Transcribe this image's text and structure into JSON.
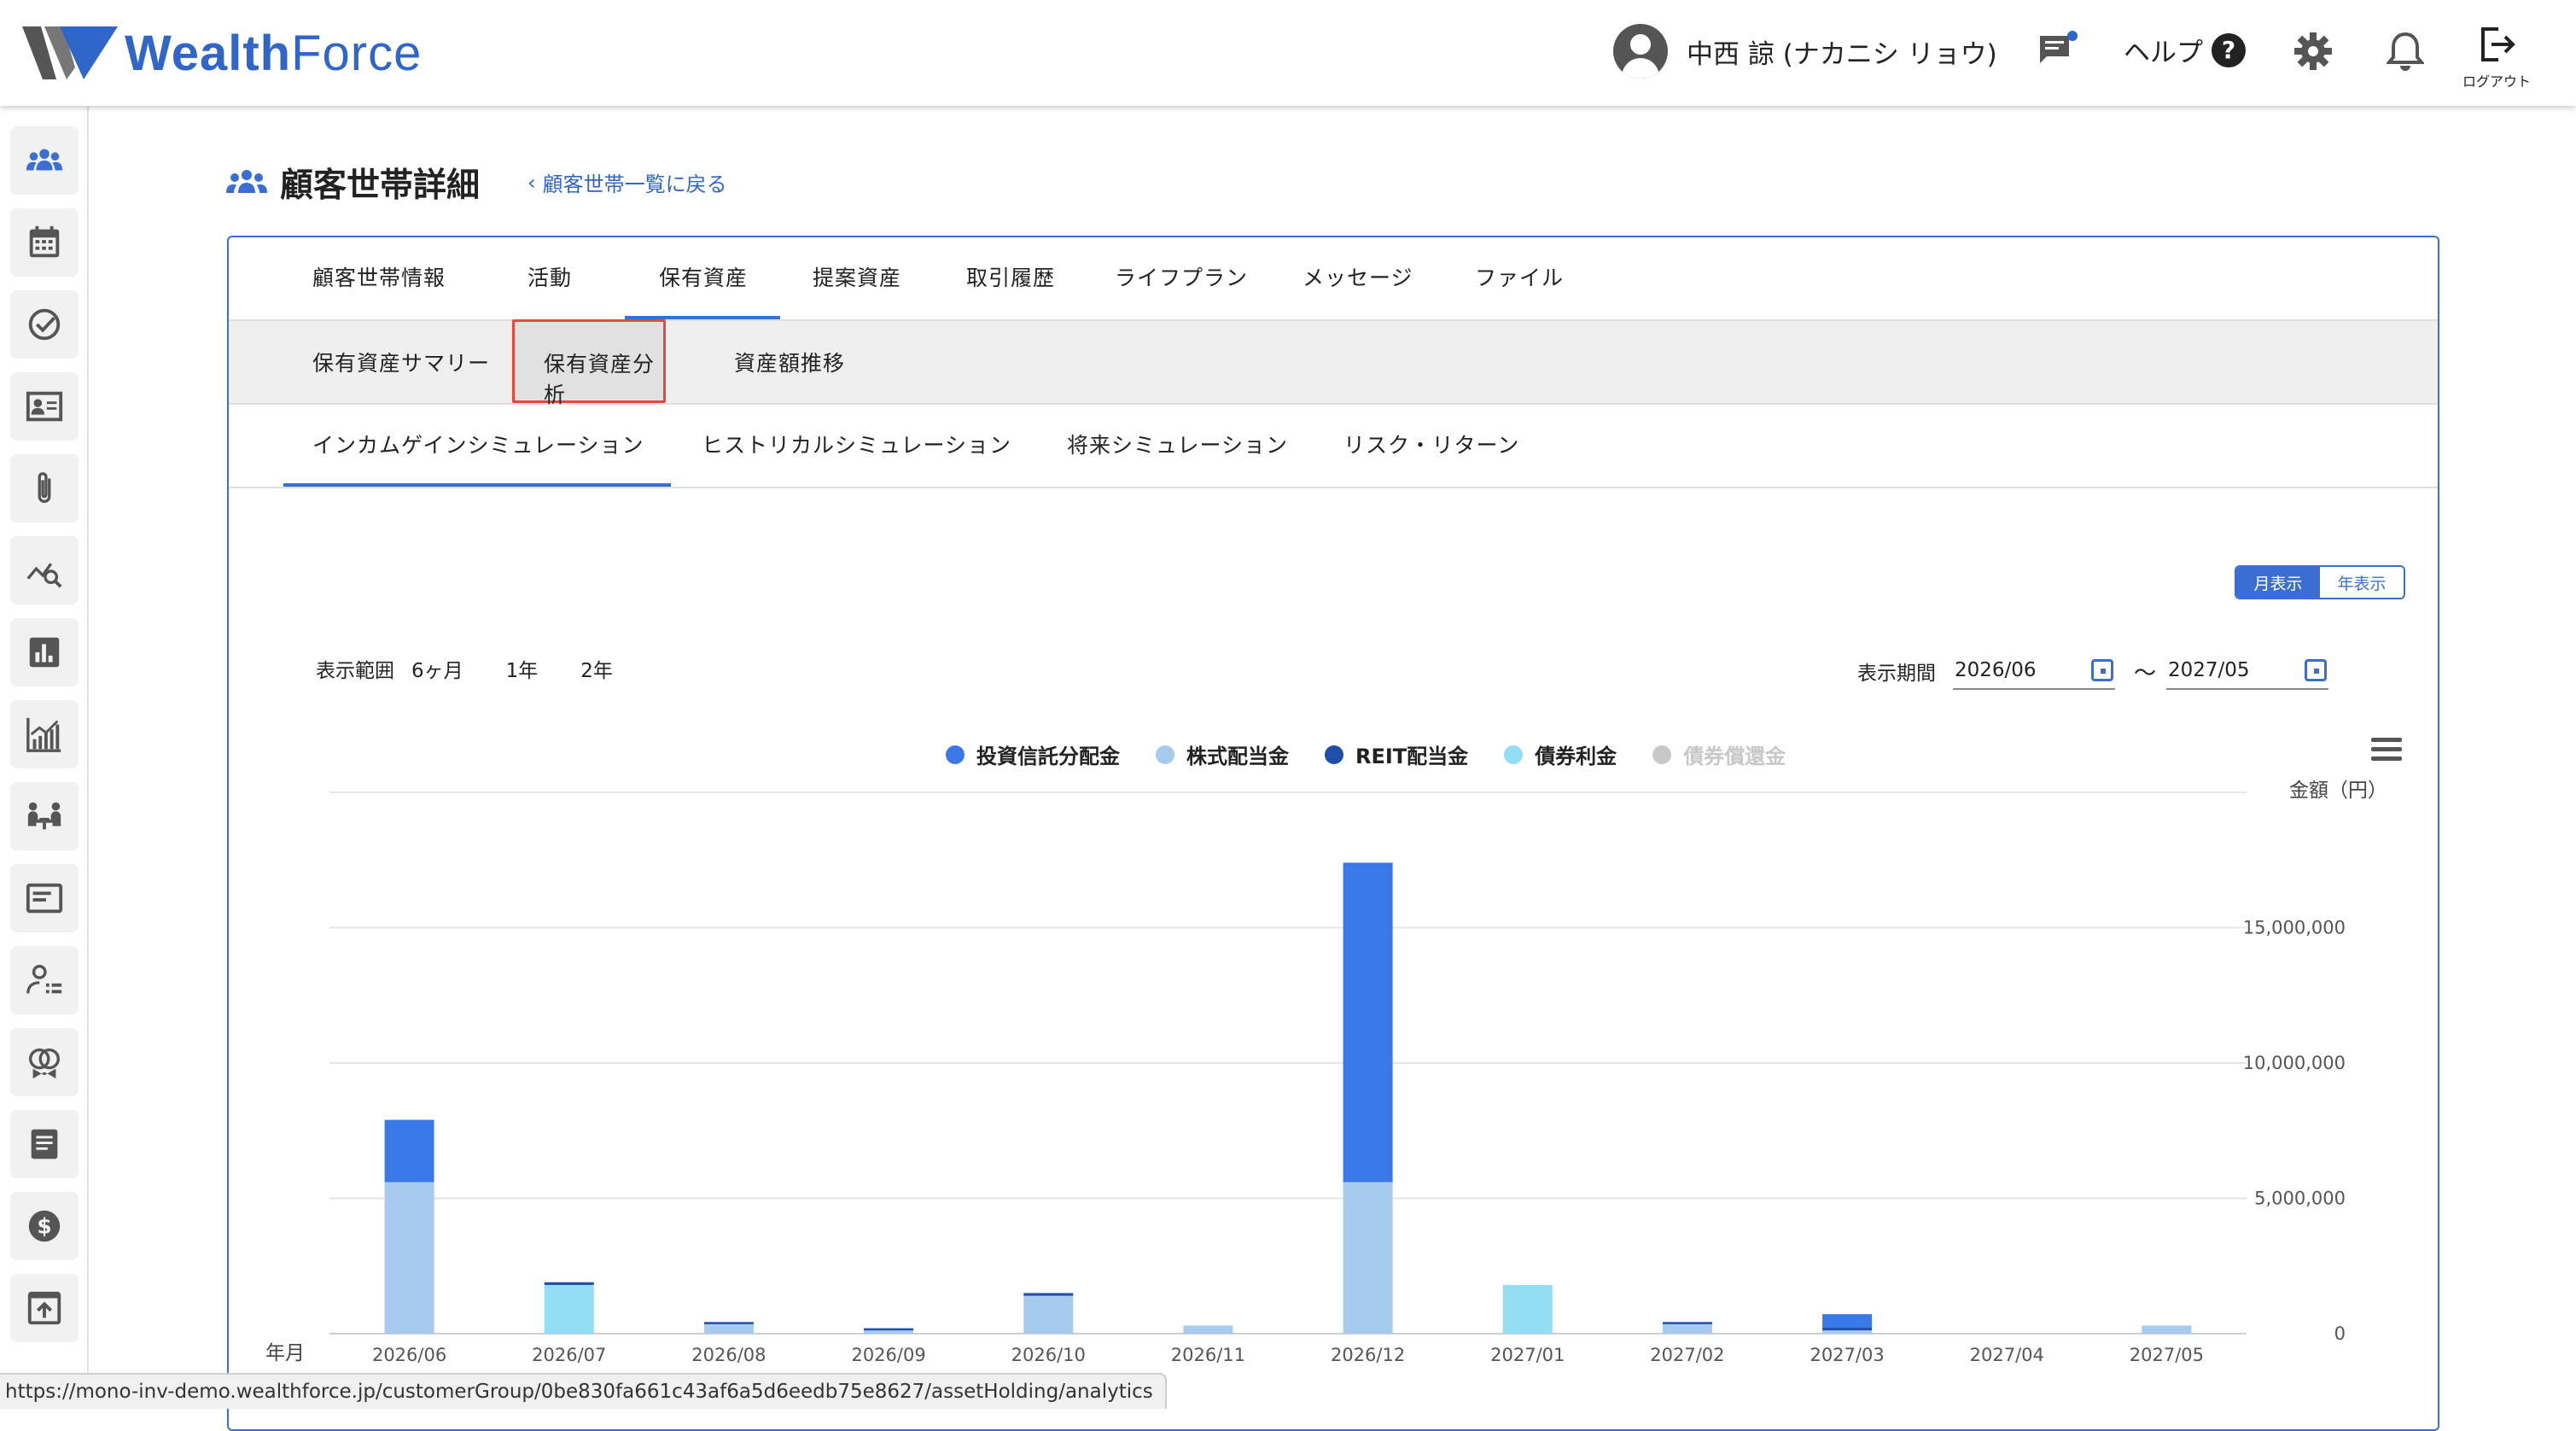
{
  "app": {
    "logo_text_bold": "Wealth",
    "logo_text_light": "Force",
    "brand_color": "#2f66c8"
  },
  "header": {
    "user_name": "中西 諒 (ナカニシ リョウ)",
    "help_label": "ヘルプ",
    "help_symbol": "?",
    "logout_label": "ログアウト"
  },
  "sidebar": {
    "items": [
      {
        "icon": "people-icon",
        "active": true
      },
      {
        "icon": "calendar-icon"
      },
      {
        "icon": "check-circle-icon"
      },
      {
        "icon": "contact-card-icon"
      },
      {
        "icon": "paperclip-icon"
      },
      {
        "icon": "chart-search-icon"
      },
      {
        "icon": "bar-chart-box-icon"
      },
      {
        "icon": "growth-chart-icon"
      },
      {
        "icon": "meeting-icon"
      },
      {
        "icon": "window-icon"
      },
      {
        "icon": "user-list-icon"
      },
      {
        "icon": "rings-icon"
      },
      {
        "icon": "document-icon"
      },
      {
        "icon": "dollar-icon"
      },
      {
        "icon": "upload-box-icon"
      }
    ]
  },
  "page": {
    "title": "顧客世帯詳細",
    "back_link": "顧客世帯一覧に戻る"
  },
  "tabs_main": [
    {
      "label": "顧客世帯情報"
    },
    {
      "label": "活動"
    },
    {
      "label": "保有資産",
      "active": true
    },
    {
      "label": "提案資産"
    },
    {
      "label": "取引履歴"
    },
    {
      "label": "ライフプラン"
    },
    {
      "label": "メッセージ"
    },
    {
      "label": "ファイル"
    }
  ],
  "tabs_sub": [
    {
      "label": "保有資産サマリー"
    },
    {
      "label": "保有資産分析",
      "active": true
    },
    {
      "label": "資産額推移"
    }
  ],
  "tabs_sim": [
    {
      "label": "インカムゲインシミュレーション",
      "active": true
    },
    {
      "label": "ヒストリカルシミュレーション"
    },
    {
      "label": "将来シミュレーション"
    },
    {
      "label": "リスク・リターン"
    }
  ],
  "view_toggle": {
    "month": "月表示",
    "year": "年表示",
    "selected": "月表示"
  },
  "range": {
    "label": "表示範囲",
    "options": [
      "6ヶ月",
      "1年",
      "2年"
    ]
  },
  "period": {
    "label": "表示期間",
    "from": "2026/06",
    "to": "2027/05",
    "separator": "〜"
  },
  "status_url": "https://mono-inv-demo.wealthforce.jp/customerGroup/0be830fa661c43af6a5d6eedb75e8627/assetHolding/analytics",
  "chart_data": {
    "type": "bar",
    "stacked": true,
    "x_axis_title": "年月",
    "y_axis_title": "金額（円）",
    "y_axis_position": "right",
    "ylim": [
      0,
      20000000
    ],
    "yticks": [
      0,
      5000000,
      10000000,
      15000000
    ],
    "ytick_labels": [
      "0",
      "5,000,000",
      "10,000,000",
      "15,000,000"
    ],
    "categories": [
      "2026/06",
      "2026/07",
      "2026/08",
      "2026/09",
      "2026/10",
      "2026/11",
      "2026/12",
      "2027/01",
      "2027/02",
      "2027/03",
      "2027/04",
      "2027/05"
    ],
    "legend_position": "top",
    "series": [
      {
        "name": "株式配当金",
        "color": "#a6cbee",
        "values": [
          5600000,
          0,
          350000,
          120000,
          1400000,
          300000,
          5600000,
          0,
          350000,
          120000,
          0,
          300000
        ]
      },
      {
        "name": "債券利金",
        "color": "#93ddf5",
        "values": [
          0,
          1800000,
          0,
          0,
          0,
          0,
          0,
          1800000,
          0,
          0,
          0,
          0
        ]
      },
      {
        "name": "REIT配当金",
        "color": "#1f4fa8",
        "values": [
          0,
          100000,
          80000,
          80000,
          100000,
          0,
          0,
          0,
          80000,
          100000,
          0,
          0
        ]
      },
      {
        "name": "投資信託分配金",
        "color": "#3a78e8",
        "values": [
          2300000,
          0,
          0,
          0,
          0,
          0,
          11800000,
          0,
          0,
          500000,
          0,
          0
        ]
      },
      {
        "name": "債券償還金",
        "color": "#c8c8c8",
        "values": [
          0,
          0,
          0,
          0,
          0,
          0,
          0,
          0,
          0,
          0,
          0,
          0
        ],
        "hidden": true
      }
    ],
    "legend_order": [
      "投資信託分配金",
      "株式配当金",
      "REIT配当金",
      "債券利金",
      "債券償還金"
    ]
  }
}
